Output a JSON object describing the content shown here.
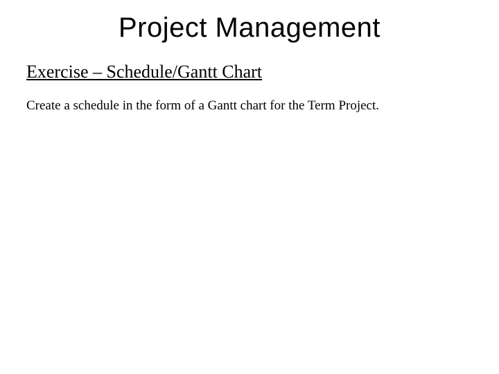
{
  "slide": {
    "title": "Project Management",
    "subtitle": "Exercise – Schedule/Gantt Chart",
    "body": "Create a schedule in the form of a Gantt chart for the Term Project."
  }
}
